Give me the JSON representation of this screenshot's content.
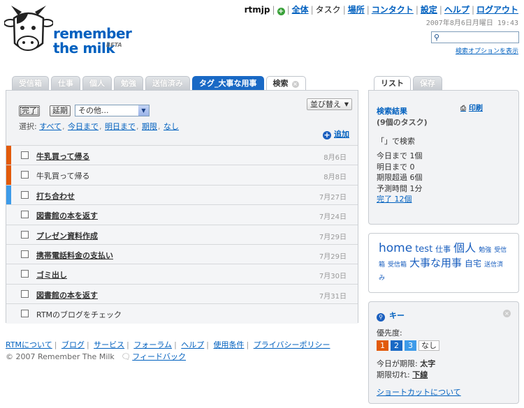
{
  "brand": {
    "line1": "remember",
    "line2": "the milk",
    "beta": "BETA"
  },
  "topnav": {
    "user": "rtmjp",
    "items": [
      {
        "label": "全体",
        "link": true
      },
      {
        "label": "タスク",
        "link": false
      },
      {
        "label": "場所",
        "link": true
      },
      {
        "label": "コンタクト",
        "link": true
      },
      {
        "label": "設定",
        "link": true
      },
      {
        "label": "ヘルプ",
        "link": true
      },
      {
        "label": "ログアウト",
        "link": true
      }
    ],
    "date": "2007年8月6日月曜日 19:43"
  },
  "search": {
    "value": "",
    "options_link": "検索オプションを表示"
  },
  "tabs": [
    {
      "label": "受信箱",
      "state": "normal"
    },
    {
      "label": "仕事",
      "state": "normal"
    },
    {
      "label": "個人",
      "state": "normal"
    },
    {
      "label": "勉強",
      "state": "normal"
    },
    {
      "label": "送信済み",
      "state": "normal"
    },
    {
      "label": "タグ_大事な用事",
      "state": "blue"
    },
    {
      "label": "検索",
      "state": "active"
    }
  ],
  "toolbar": {
    "sort": "並び替え",
    "done": "完了",
    "postpone": "延期",
    "other": "その他...",
    "select_label": "選択:",
    "select_links": [
      "すべて",
      "今日まで",
      "明日まで",
      "期限",
      "なし"
    ],
    "add": "追加"
  },
  "tasks": [
    {
      "name": "牛乳買って帰る",
      "due": "8月6日",
      "color": "#e25a0b",
      "bold": true
    },
    {
      "name": "牛乳買って帰る",
      "due": "8月8日",
      "color": "#e25a0b",
      "bold": false
    },
    {
      "name": "打ち合わせ",
      "due": "7月27日",
      "color": "#3d9be9",
      "bold": true
    },
    {
      "name": "図書館の本を返す",
      "due": "7月24日",
      "color": "",
      "bold": true
    },
    {
      "name": "プレゼン資料作成",
      "due": "7月29日",
      "color": "",
      "bold": true
    },
    {
      "name": "携帯電話料金の支払い",
      "due": "7月29日",
      "color": "",
      "bold": true
    },
    {
      "name": "ゴミ出し",
      "due": "7月30日",
      "color": "",
      "bold": true
    },
    {
      "name": "図書館の本を返す",
      "due": "7月31日",
      "color": "",
      "bold": true
    },
    {
      "name": "RTMのブログをチェック",
      "due": "",
      "color": "",
      "bold": false
    }
  ],
  "footer": {
    "links": [
      "RTMについて",
      "ブログ",
      "サービス",
      "フォーラム",
      "ヘルプ",
      "使用条件",
      "プライバシーポリシー"
    ],
    "copyright": "© 2007 Remember The Milk",
    "feedback": "フィードバック"
  },
  "right_tabs": [
    {
      "label": "リスト",
      "state": "active"
    },
    {
      "label": "保存",
      "state": "normal"
    }
  ],
  "results": {
    "title": "検索結果",
    "count": "(9個のタスク)",
    "print": "印刷",
    "query": "「」で検索",
    "stats": [
      "今日まで 1個",
      "明日まで 0",
      "期限超過 6個",
      "予測時間 1分"
    ],
    "done_link": "完了 12個"
  },
  "tag_cloud": [
    {
      "label": "home",
      "size": 17
    },
    {
      "label": "test",
      "size": 13
    },
    {
      "label": "仕事",
      "size": 11
    },
    {
      "label": "個人",
      "size": 16
    },
    {
      "label": "勉強",
      "size": 9
    },
    {
      "label": "受信箱",
      "size": 9
    },
    {
      "label": "受信箱",
      "size": 9
    },
    {
      "label": "大事な用事",
      "size": 15
    },
    {
      "label": "自宅",
      "size": 12
    },
    {
      "label": "送信済み",
      "size": 9
    }
  ],
  "key": {
    "title": "キー",
    "priority_label": "優先度:",
    "chips": [
      {
        "label": "1",
        "color": "#e25a0b"
      },
      {
        "label": "2",
        "color": "#1969c5"
      },
      {
        "label": "3",
        "color": "#3d9be9"
      },
      {
        "label": "なし",
        "color": "#ffffff"
      }
    ],
    "today_label": "今日が期限: ",
    "today_value": "太字",
    "overdue_label": "期限切れ: ",
    "overdue_value": "下線",
    "shortcut_link": "ショートカットについて"
  }
}
